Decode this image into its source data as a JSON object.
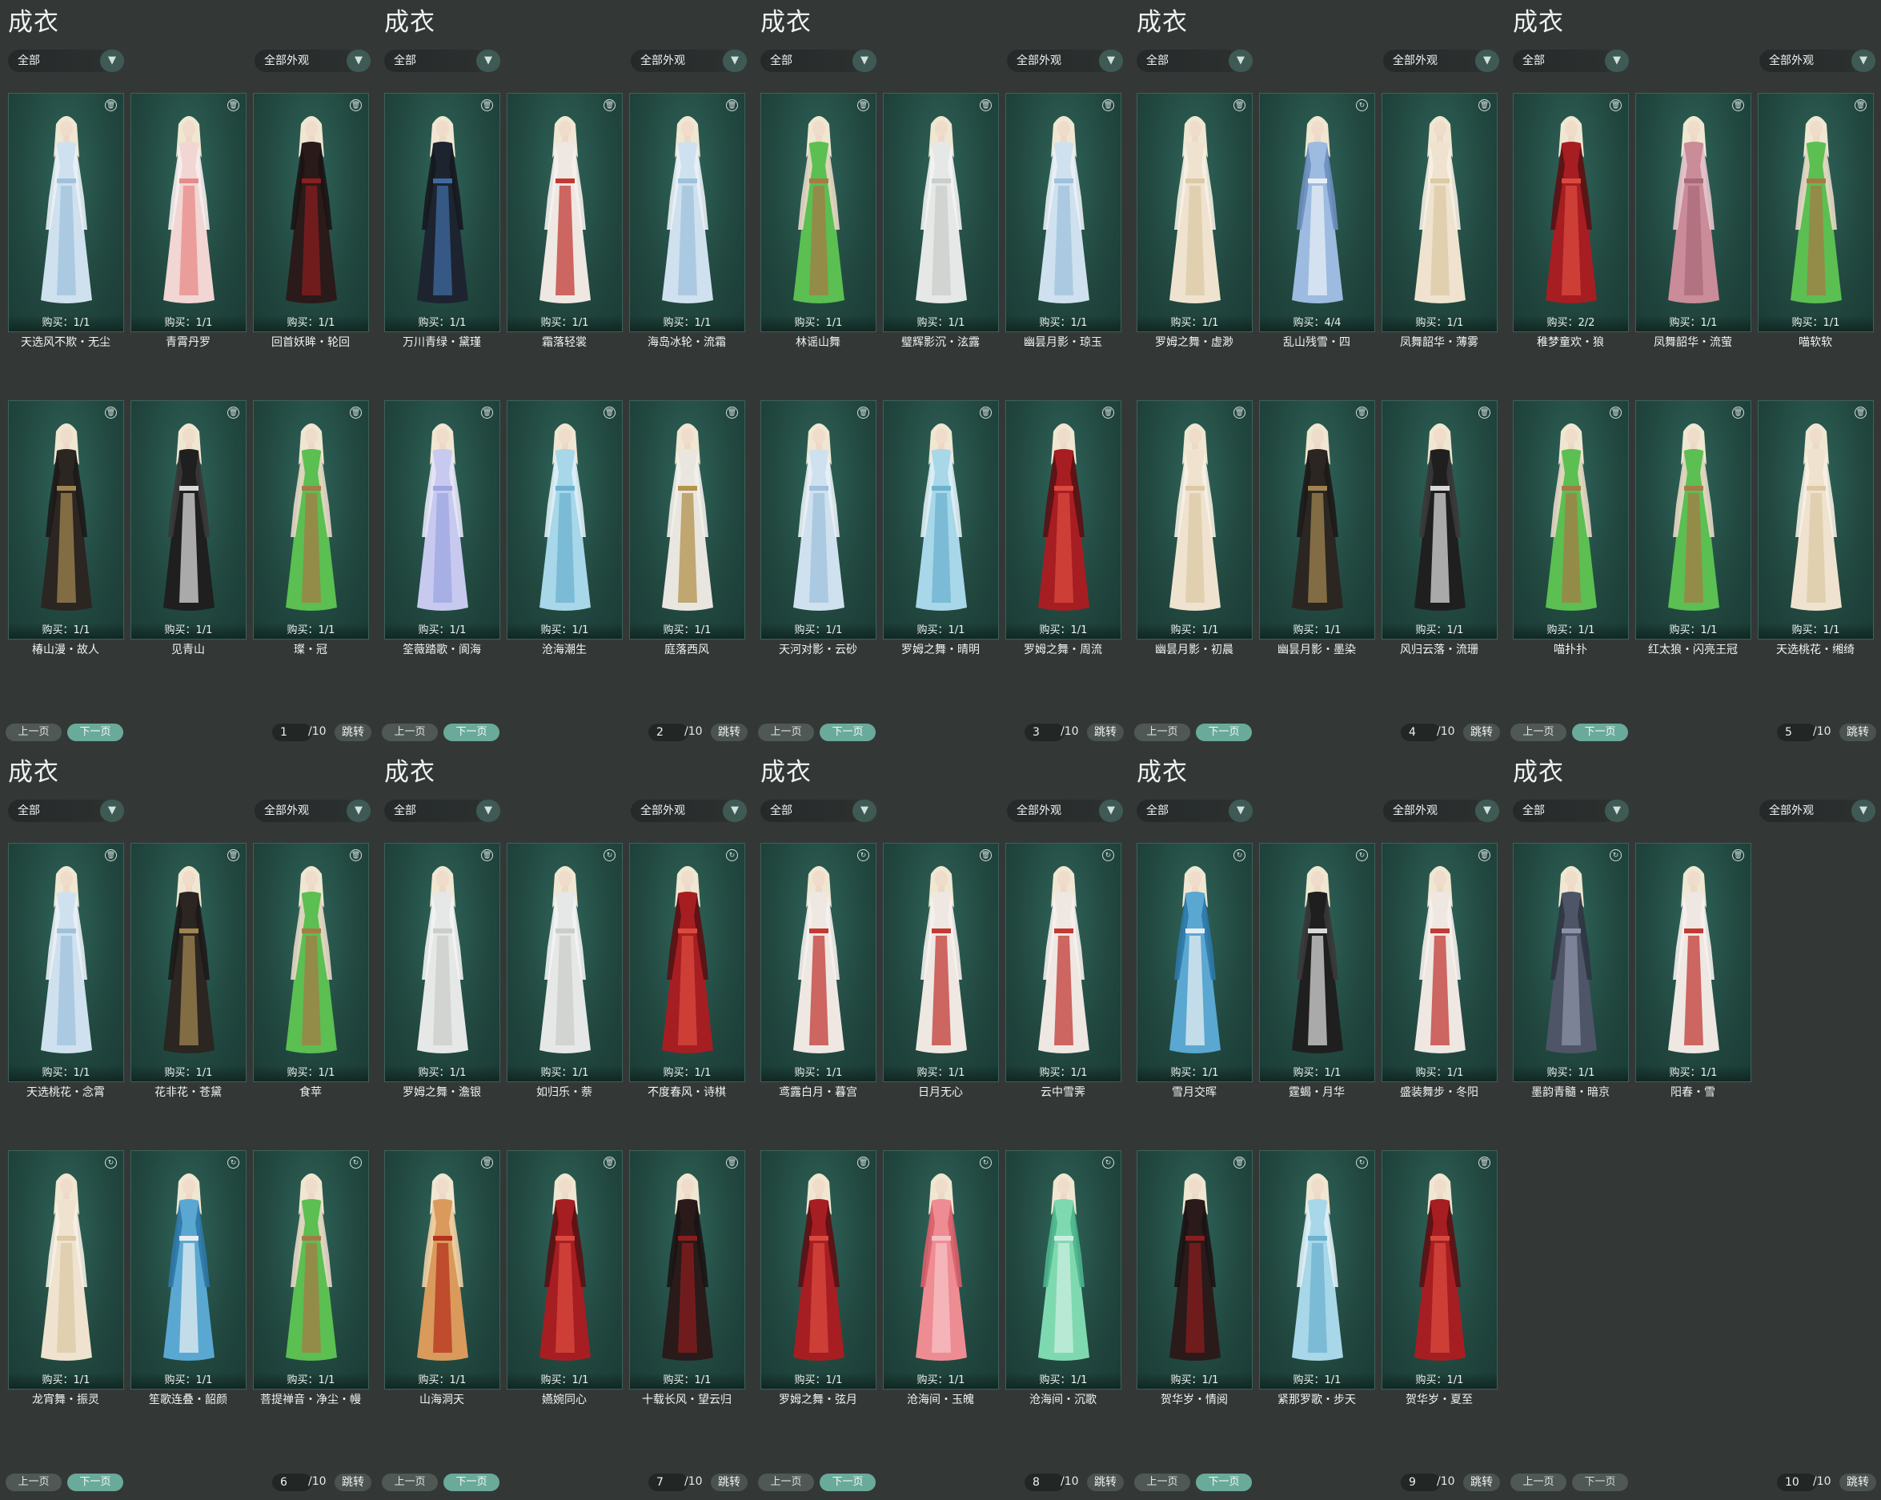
{
  "theme": {
    "card_bg": "#234942",
    "next_button": "#6aaa9a",
    "panel_bg": "#333836"
  },
  "panels": [
    {
      "title": "成衣",
      "filter_category": "全部",
      "filter_appearance": "全部外观",
      "page_current": "1",
      "page_total": "/10",
      "prev_label": "上一页",
      "next_label": "下一页",
      "jump_label": "跳转",
      "cards": [
        {
          "name": "天选风不欺・无尘",
          "buy": "购买：1/1",
          "icon": "trash-icon",
          "palette": "iceblue"
        },
        {
          "name": "青霄丹罗",
          "buy": "购买：1/1",
          "icon": "trash-icon",
          "palette": "pinkwhite"
        },
        {
          "name": "回首妖眸・轮回",
          "buy": "购买：1/1",
          "icon": "trash-icon",
          "palette": "blackred"
        },
        {
          "name": "椿山漫・故人",
          "buy": "购买：1/1",
          "icon": "trash-icon",
          "palette": "blackgold"
        },
        {
          "name": "见青山",
          "buy": "购买：1/1",
          "icon": "trash-icon",
          "palette": "blackwhite"
        },
        {
          "name": "璨・冠",
          "buy": "购买：1/1",
          "icon": "trash-icon",
          "palette": "green"
        }
      ]
    },
    {
      "title": "成衣",
      "filter_category": "全部",
      "filter_appearance": "全部外观",
      "page_current": "2",
      "page_total": "/10",
      "prev_label": "上一页",
      "next_label": "下一页",
      "jump_label": "跳转",
      "cards": [
        {
          "name": "万川青绿・黛瑾",
          "buy": "购买：1/1",
          "icon": "trash-icon",
          "palette": "blackblue"
        },
        {
          "name": "霜落轻裳",
          "buy": "购买：1/1",
          "icon": "trash-icon",
          "palette": "whitered"
        },
        {
          "name": "海岛冰轮・流霜",
          "buy": "购买：1/1",
          "icon": "trash-icon",
          "palette": "iceblue"
        },
        {
          "name": "筌薇踏歌・阆海",
          "buy": "购买：1/1",
          "icon": "trash-icon",
          "palette": "lavender"
        },
        {
          "name": "沧海潮生",
          "buy": "购买：1/1",
          "icon": "trash-icon",
          "palette": "skyblue"
        },
        {
          "name": "庭落西风",
          "buy": "购买：1/1",
          "icon": "trash-icon",
          "palette": "whitegold"
        }
      ]
    },
    {
      "title": "成衣",
      "filter_category": "全部",
      "filter_appearance": "全部外观",
      "page_current": "3",
      "page_total": "/10",
      "prev_label": "上一页",
      "next_label": "下一页",
      "jump_label": "跳转",
      "cards": [
        {
          "name": "林谣山舞",
          "buy": "购买：1/1",
          "icon": "trash-icon",
          "palette": "green"
        },
        {
          "name": "璧辉影沉・泫露",
          "buy": "购买：1/1",
          "icon": "trash-icon",
          "palette": "pearl"
        },
        {
          "name": "幽昙月影・琼玉",
          "buy": "购买：1/1",
          "icon": "trash-icon",
          "palette": "iceblue"
        },
        {
          "name": "天河对影・云砂",
          "buy": "购买：1/1",
          "icon": "trash-icon",
          "palette": "iceblue"
        },
        {
          "name": "罗姆之舞・晴明",
          "buy": "购买：1/1",
          "icon": "trash-icon",
          "palette": "skyblue"
        },
        {
          "name": "罗姆之舞・周流",
          "buy": "购买：1/1",
          "icon": "trash-icon",
          "palette": "red"
        }
      ]
    },
    {
      "title": "成衣",
      "filter_category": "全部",
      "filter_appearance": "全部外观",
      "page_current": "4",
      "page_total": "/10",
      "prev_label": "上一页",
      "next_label": "下一页",
      "jump_label": "跳转",
      "cards": [
        {
          "name": "罗姆之舞・虚渺",
          "buy": "购买：1/1",
          "icon": "trash-icon",
          "palette": "cream"
        },
        {
          "name": "乱山残雪・四",
          "buy": "购买：4/4",
          "icon": "refresh-icon",
          "palette": "winterblue"
        },
        {
          "name": "凤舞韶华・薄雾",
          "buy": "购买：1/1",
          "icon": "trash-icon",
          "palette": "cream"
        },
        {
          "name": "幽昙月影・初晨",
          "buy": "购买：1/1",
          "icon": "trash-icon",
          "palette": "cream"
        },
        {
          "name": "幽昙月影・墨染",
          "buy": "购买：1/1",
          "icon": "trash-icon",
          "palette": "blackgold"
        },
        {
          "name": "风归云落・流珊",
          "buy": "购买：1/1",
          "icon": "trash-icon",
          "palette": "blackwhite"
        }
      ]
    },
    {
      "title": "成衣",
      "filter_category": "全部",
      "filter_appearance": "全部外观",
      "page_current": "5",
      "page_total": "/10",
      "prev_label": "上一页",
      "next_label": "下一页",
      "jump_label": "跳转",
      "cards": [
        {
          "name": "稚梦童欢・狼",
          "buy": "购买：2/2",
          "icon": "trash-icon",
          "palette": "red"
        },
        {
          "name": "凤舞韶华・流萤",
          "buy": "购买：1/1",
          "icon": "trash-icon",
          "palette": "rose"
        },
        {
          "name": "喵软软",
          "buy": "购买：1/1",
          "icon": "trash-icon",
          "palette": "green"
        },
        {
          "name": "喵扑扑",
          "buy": "购买：1/1",
          "icon": "trash-icon",
          "palette": "green"
        },
        {
          "name": "红太狼・闪亮王冠",
          "buy": "购买：1/1",
          "icon": "trash-icon",
          "palette": "green"
        },
        {
          "name": "天选桃花・缃绮",
          "buy": "购买：1/1",
          "icon": "trash-icon",
          "palette": "cream"
        }
      ]
    },
    {
      "title": "成衣",
      "filter_category": "全部",
      "filter_appearance": "全部外观",
      "page_current": "6",
      "page_total": "/10",
      "prev_label": "上一页",
      "next_label": "下一页",
      "jump_label": "跳转",
      "cards": [
        {
          "name": "天选桃花・念霄",
          "buy": "购买：1/1",
          "icon": "trash-icon",
          "palette": "iceblue"
        },
        {
          "name": "花非花・苍黛",
          "buy": "购买：1/1",
          "icon": "trash-icon",
          "palette": "blackgold"
        },
        {
          "name": "食苹",
          "buy": "购买：1/1",
          "icon": "trash-icon",
          "palette": "green"
        },
        {
          "name": "龙宵舞・振灵",
          "buy": "购买：1/1",
          "icon": "refresh-icon",
          "palette": "cream"
        },
        {
          "name": "笙歌连叠・韶颜",
          "buy": "购买：1/1",
          "icon": "refresh-icon",
          "palette": "tealblue"
        },
        {
          "name": "菩提禅音・净尘・幔",
          "buy": "购买：1/1",
          "icon": "refresh-icon",
          "palette": "green"
        }
      ]
    },
    {
      "title": "成衣",
      "filter_category": "全部",
      "filter_appearance": "全部外观",
      "page_current": "7",
      "page_total": "/10",
      "prev_label": "上一页",
      "next_label": "下一页",
      "jump_label": "跳转",
      "cards": [
        {
          "name": "罗姆之舞・澹银",
          "buy": "购买：1/1",
          "icon": "trash-icon",
          "palette": "pearl"
        },
        {
          "name": "如归乐・萘",
          "buy": "购买：1/1",
          "icon": "refresh-icon",
          "palette": "pearl"
        },
        {
          "name": "不度春风・诗棋",
          "buy": "购买：1/1",
          "icon": "refresh-icon",
          "palette": "red"
        },
        {
          "name": "山海洞天",
          "buy": "购买：1/1",
          "icon": "trash-icon",
          "palette": "amber"
        },
        {
          "name": "嬿婉同心",
          "buy": "购买：1/1",
          "icon": "trash-icon",
          "palette": "red"
        },
        {
          "name": "十载长风・望云归",
          "buy": "购买：1/1",
          "icon": "trash-icon",
          "palette": "blackred"
        }
      ]
    },
    {
      "title": "成衣",
      "filter_category": "全部",
      "filter_appearance": "全部外观",
      "page_current": "8",
      "page_total": "/10",
      "prev_label": "上一页",
      "next_label": "下一页",
      "jump_label": "跳转",
      "cards": [
        {
          "name": "鸢露白月・暮宫",
          "buy": "购买：1/1",
          "icon": "refresh-icon",
          "palette": "whitered"
        },
        {
          "name": "日月无心",
          "buy": "购买：1/1",
          "icon": "trash-icon",
          "palette": "whitered"
        },
        {
          "name": "云中雪霁",
          "buy": "购买：1/1",
          "icon": "refresh-icon",
          "palette": "whitered"
        },
        {
          "name": "罗姆之舞・弦月",
          "buy": "购买：1/1",
          "icon": "trash-icon",
          "palette": "red"
        },
        {
          "name": "沧海间・玉魄",
          "buy": "购买：1/1",
          "icon": "refresh-icon",
          "palette": "pink"
        },
        {
          "name": "沧海间・沉歌",
          "buy": "购买：1/1",
          "icon": "refresh-icon",
          "palette": "mint"
        }
      ]
    },
    {
      "title": "成衣",
      "filter_category": "全部",
      "filter_appearance": "全部外观",
      "page_current": "9",
      "page_total": "/10",
      "prev_label": "上一页",
      "next_label": "下一页",
      "jump_label": "跳转",
      "cards": [
        {
          "name": "雪月交晖",
          "buy": "购买：1/1",
          "icon": "refresh-icon",
          "palette": "tealblue"
        },
        {
          "name": "霆蝎・月华",
          "buy": "购买：1/1",
          "icon": "refresh-icon",
          "palette": "blackwhite"
        },
        {
          "name": "盛装舞步・冬阳",
          "buy": "购买：1/1",
          "icon": "trash-icon",
          "palette": "whitered"
        },
        {
          "name": "贺华岁・情阅",
          "buy": "购买：1/1",
          "icon": "trash-icon",
          "palette": "blackred"
        },
        {
          "name": "紧那罗歌・步天",
          "buy": "购买：1/1",
          "icon": "refresh-icon",
          "palette": "skyblue"
        },
        {
          "name": "贺华岁・夏至",
          "buy": "购买：1/1",
          "icon": "trash-icon",
          "palette": "red"
        }
      ]
    },
    {
      "title": "成衣",
      "filter_category": "全部",
      "filter_appearance": "全部外观",
      "page_current": "10",
      "page_total": "/10",
      "prev_label": "上一页",
      "next_label": "下一页",
      "jump_label": "跳转",
      "next_disabled": true,
      "cards": [
        {
          "name": "墨韵青髓・暗京",
          "buy": "购买：1/1",
          "icon": "refresh-icon",
          "palette": "slate"
        },
        {
          "name": "阳春・雪",
          "buy": "购买：1/1",
          "icon": "trash-icon",
          "palette": "whitered"
        }
      ]
    }
  ]
}
